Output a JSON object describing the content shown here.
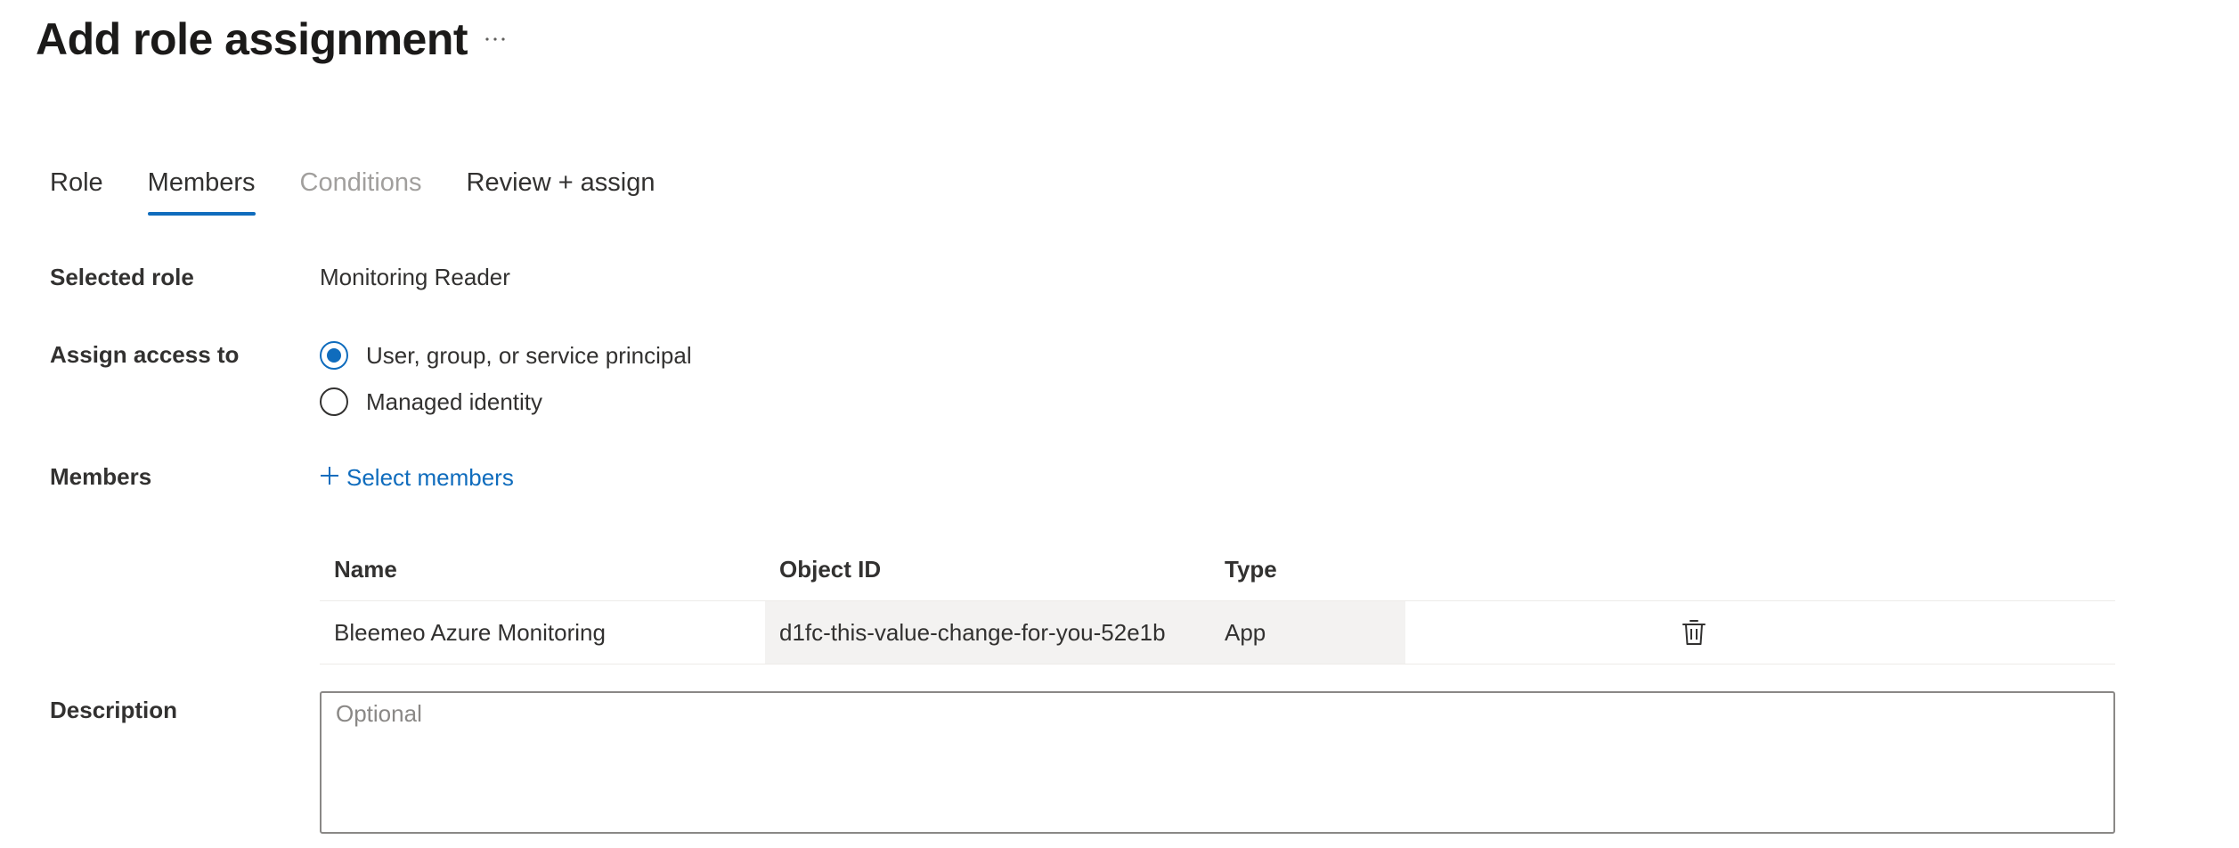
{
  "page_title": "Add role assignment",
  "more_label": "···",
  "tabs": [
    {
      "label": "Role",
      "state": "normal"
    },
    {
      "label": "Members",
      "state": "active"
    },
    {
      "label": "Conditions",
      "state": "disabled"
    },
    {
      "label": "Review + assign",
      "state": "normal"
    }
  ],
  "selected_role": {
    "label": "Selected role",
    "value": "Monitoring Reader"
  },
  "assign_access": {
    "label": "Assign access to",
    "options": [
      {
        "label": "User, group, or service principal",
        "checked": true
      },
      {
        "label": "Managed identity",
        "checked": false
      }
    ]
  },
  "members": {
    "label": "Members",
    "select_label": "Select members",
    "columns": [
      "Name",
      "Object ID",
      "Type"
    ],
    "rows": [
      {
        "name": "Bleemeo Azure Monitoring",
        "object_id": "d1fc-this-value-change-for-you-52e1b",
        "type": "App"
      }
    ]
  },
  "description": {
    "label": "Description",
    "placeholder": "Optional",
    "value": ""
  },
  "colors": {
    "accent": "#0f6cbd",
    "text": "#323130",
    "disabled": "#a19f9d"
  },
  "icons": {
    "more": "more-horizontal-icon",
    "add": "plus-icon",
    "delete": "trash-icon"
  }
}
